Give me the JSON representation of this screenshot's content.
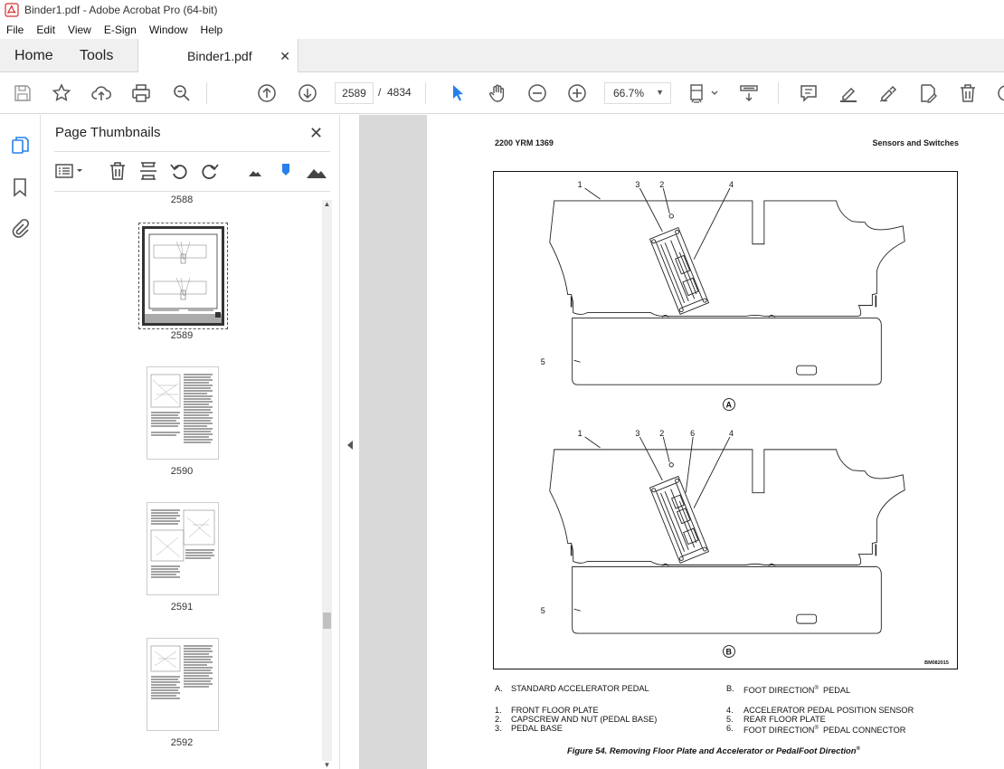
{
  "window": {
    "title": "Binder1.pdf - Adobe Acrobat Pro (64-bit)"
  },
  "menu": [
    "File",
    "Edit",
    "View",
    "E-Sign",
    "Window",
    "Help"
  ],
  "tabs": {
    "home": "Home",
    "tools": "Tools",
    "document": "Binder1.pdf"
  },
  "toolbar": {
    "current_page": "2589",
    "page_separator": "/",
    "total_pages": "4834",
    "zoom": "66.7%"
  },
  "thumbnails": {
    "title": "Page Thumbnails",
    "pages": [
      "2588",
      "2589",
      "2590",
      "2591",
      "2592"
    ],
    "selected": "2589"
  },
  "document": {
    "header_left": "2200 YRM 1369",
    "header_right": "Sensors and Switches",
    "figure": {
      "callouts_a": [
        "1",
        "3",
        "2",
        "4",
        "5"
      ],
      "callouts_b": [
        "1",
        "3",
        "2",
        "6",
        "4",
        "5"
      ],
      "view_a": "A",
      "view_b": "B",
      "code": "BM082015"
    },
    "legend": {
      "a": "A.",
      "a_text": "STANDARD ACCELERATOR PEDAL",
      "b": "B.",
      "b_text": "FOOT DIRECTION",
      "b_suffix": "PEDAL",
      "n1": "1.",
      "t1": "FRONT FLOOR PLATE",
      "n2": "2.",
      "t2": "CAPSCREW AND NUT (PEDAL BASE)",
      "n3": "3.",
      "t3": "PEDAL BASE",
      "n4": "4.",
      "t4": "ACCELERATOR PEDAL POSITION SENSOR",
      "n5": "5.",
      "t5": "REAR FLOOR PLATE",
      "n6": "6.",
      "t6": "FOOT DIRECTION",
      "t6_suffix": "PEDAL CONNECTOR",
      "reg": "®"
    },
    "caption": "Figure 54. Removing Floor Plate and Accelerator or PedalFoot Direction",
    "caption_reg": "®"
  },
  "colors": {
    "acrobat_red": "#d32f2f",
    "select_arrow_blue": "#2680eb",
    "doc_background": "#d9d9d9"
  }
}
